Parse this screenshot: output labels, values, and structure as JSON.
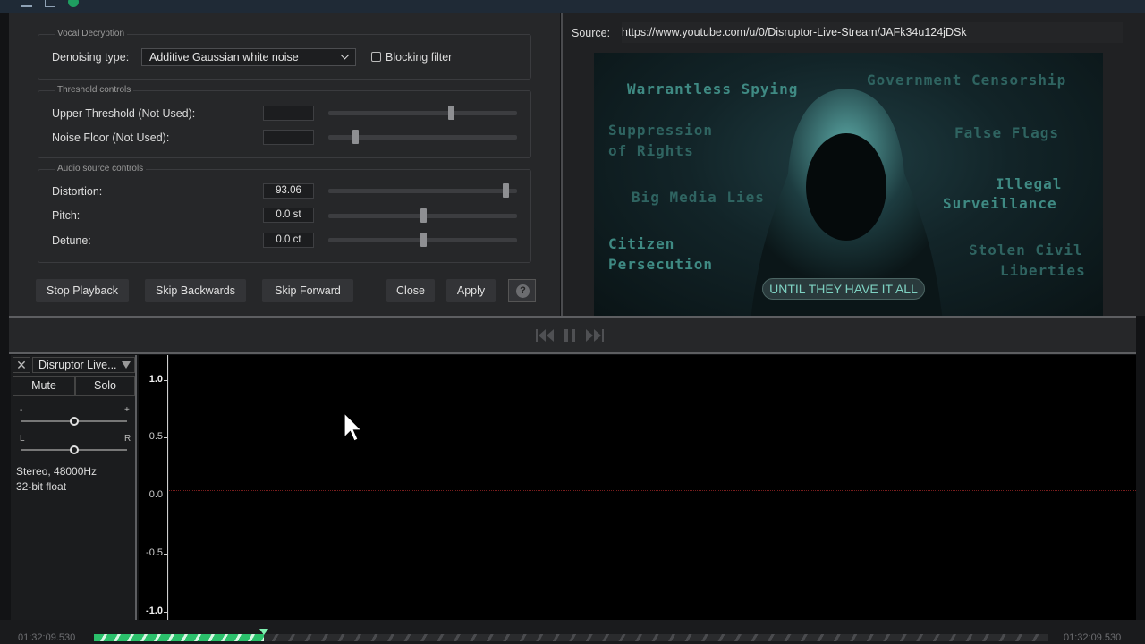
{
  "topbar": {
    "icons": [
      "menu-icon",
      "grid-icon",
      "globe-icon"
    ]
  },
  "vocal_decryption": {
    "title": "Vocal Decryption",
    "denoising_label": "Denoising type:",
    "denoising_value": "Additive Gaussian white noise",
    "blocking_filter_label": "Blocking filter",
    "blocking_filter_checked": false
  },
  "threshold_controls": {
    "title": "Threshold controls",
    "upper_label": "Upper Threshold (Not Used):",
    "upper_value": "",
    "upper_level": 0.65,
    "noise_label": "Noise Floor (Not Used):",
    "noise_value": "",
    "noise_level": 0.14
  },
  "audio_source_controls": {
    "title": "Audio source controls",
    "distortion_label": "Distortion:",
    "distortion_value": "93.06",
    "distortion_level": 0.94,
    "pitch_label": "Pitch:",
    "pitch_value": "0.0 st",
    "pitch_level": 0.5,
    "detune_label": "Detune:",
    "detune_value": "0.0 ct",
    "detune_level": 0.5
  },
  "buttons": {
    "stop": "Stop Playback",
    "skip_back": "Skip Backwards",
    "skip_forward": "Skip Forward",
    "close": "Close",
    "apply": "Apply",
    "help": "?"
  },
  "source": {
    "label": "Source:",
    "url": "https://www.youtube.com/u/0/Disruptor-Live-Stream/JAFk34u124jDSk"
  },
  "video": {
    "texts": [
      "Warrantless Spying",
      "Government Censorship",
      "Suppression",
      "of Rights",
      "False Flags",
      "Big Media Lies",
      "Illegal",
      "Surveillance",
      "Citizen",
      "Persecution",
      "Stolen Civil",
      "Liberties"
    ],
    "banner": "UNTIL THEY HAVE IT ALL"
  },
  "track": {
    "close": "✕",
    "name": "Disruptor Live...",
    "mute": "Mute",
    "solo": "Solo",
    "gain_minus": "-",
    "gain_plus": "+",
    "gain_level": 0.5,
    "pan_left": "L",
    "pan_right": "R",
    "pan_level": 0.5,
    "format": "Stereo, 48000Hz",
    "bit_depth": "32-bit float"
  },
  "ruler": {
    "ticks": [
      "1.0",
      "0.5",
      "0.0",
      "-0.5",
      "-1.0"
    ]
  },
  "timeline": {
    "start_time": "01:32:09.530",
    "end_time": "01:32:09.530",
    "progress": 0.178
  },
  "colors": {
    "accent": "#2bc06b",
    "zero_line": "#7a1d1d",
    "banner_text": "#7ed2c2"
  }
}
